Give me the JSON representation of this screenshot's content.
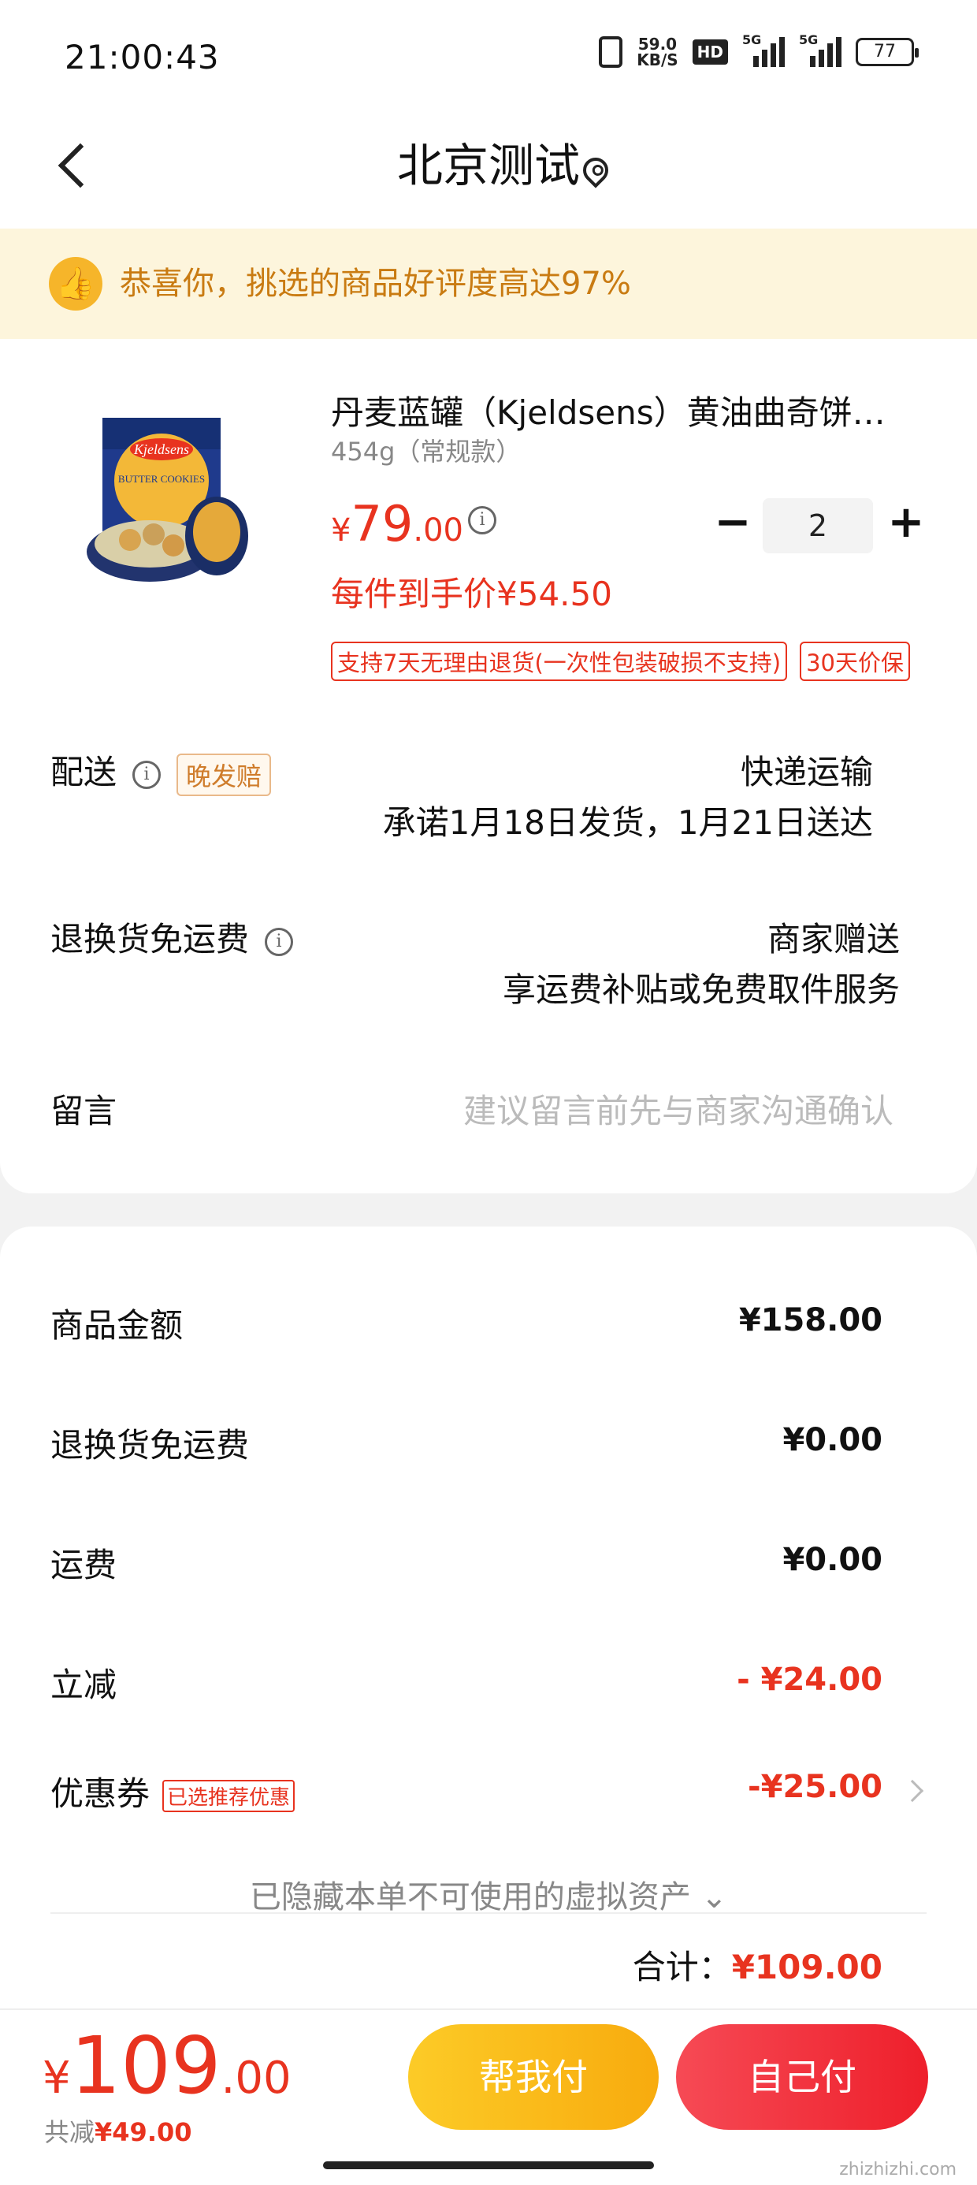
{
  "status_bar": {
    "time": "21:00:43",
    "speed_value": "59.0",
    "speed_unit": "KB/S",
    "hd": "HD",
    "sig1": "5G",
    "sig2": "5G",
    "battery": "77"
  },
  "header": {
    "title": "北京测试"
  },
  "banner": {
    "text": "恭喜你，挑选的商品好评度高达97%"
  },
  "product": {
    "name": "丹麦蓝罐（Kjeldsens）黄油曲奇饼…",
    "spec": "454g（常规款）",
    "price_currency": "¥",
    "price_int": "79",
    "price_dec": ".00",
    "quantity": "2",
    "unit_price": "每件到手价¥54.50",
    "tags": [
      "支持7天无理由退货(一次性包装破损不支持)",
      "30天价保"
    ],
    "image_brand": "Kjeldsens",
    "image_text": "BUTTER COOKIES"
  },
  "delivery": {
    "label": "配送",
    "badge": "晚发赔",
    "method": "快递运输",
    "promise": "承诺1月18日发货，1月21日送达"
  },
  "return_shipping": {
    "label": "退换货免运费",
    "value": "商家赠送",
    "desc": "享运费补贴或免费取件服务"
  },
  "note": {
    "label": "留言",
    "placeholder": "建议留言前先与商家沟通确认"
  },
  "summary": {
    "goods_label": "商品金额",
    "goods_value": "¥158.00",
    "return_label": "退换货免运费",
    "return_value": "¥0.00",
    "shipping_label": "运费",
    "shipping_value": "¥0.00",
    "discount_label": "立减",
    "discount_value": "- ¥24.00",
    "coupon_label": "优惠券",
    "coupon_tag": "已选推荐优惠",
    "coupon_value": "-¥25.00",
    "hidden_assets": "已隐藏本单不可使用的虚拟资产",
    "total_label": "合计：",
    "total_value": "¥109.00"
  },
  "bottom": {
    "currency": "¥",
    "amount_int": "109",
    "amount_dec": ".00",
    "saved_label": "共减",
    "saved_value": "¥49.00",
    "btn_friend": "帮我付",
    "btn_self": "自己付",
    "watermark": "zhizhizhi.com"
  },
  "colors": {
    "accent_red": "#e8331f",
    "banner_bg": "#fdf5dc",
    "banner_text": "#c97b12",
    "friend_btn": "#f8ab0e",
    "self_btn": "#ee1f2b"
  }
}
